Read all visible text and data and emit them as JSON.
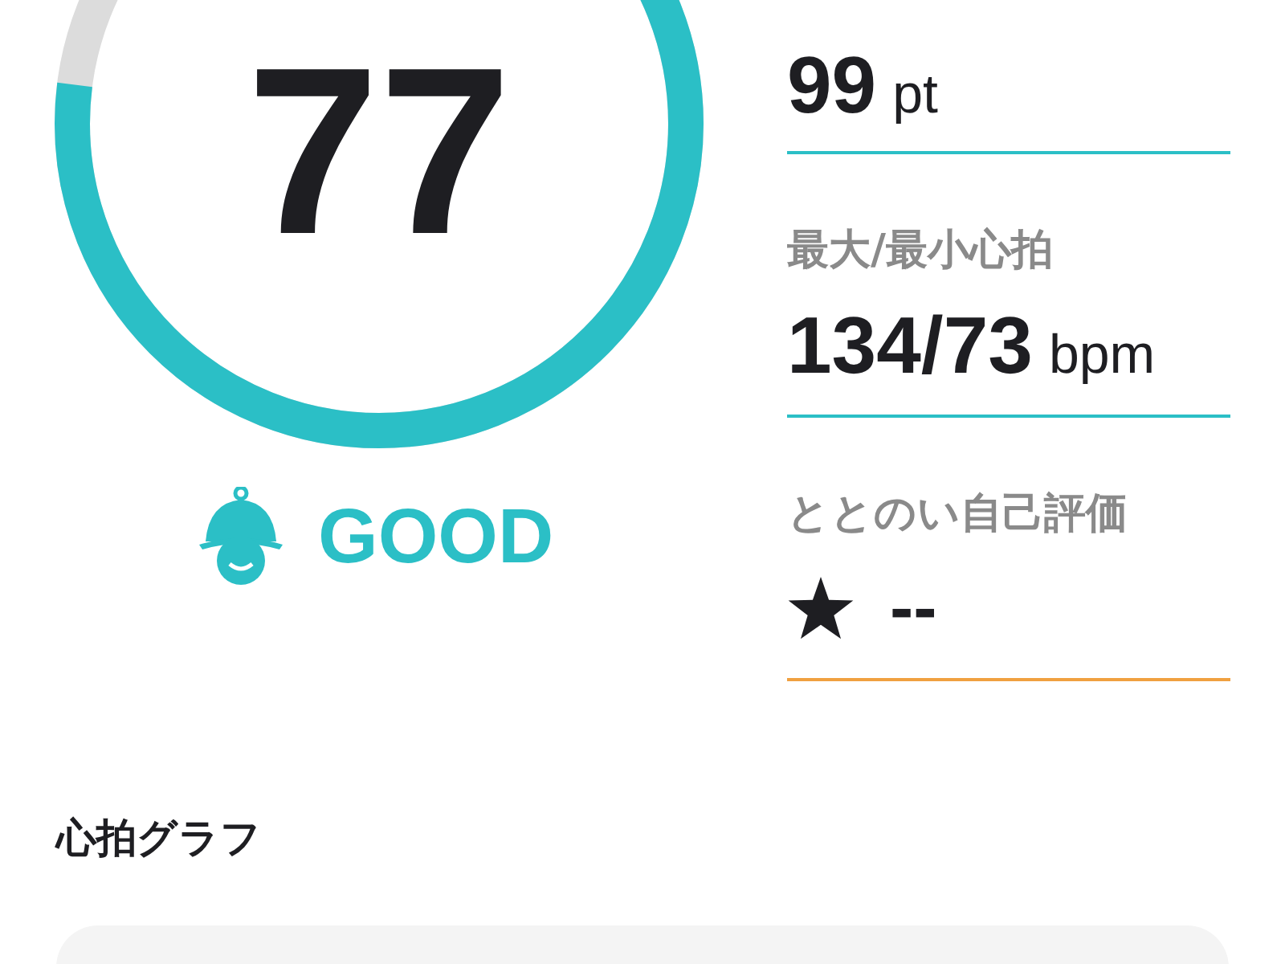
{
  "gauge": {
    "value": "77",
    "status": "GOOD"
  },
  "metrics": [
    {
      "kind": "value",
      "value": "99",
      "unit": "pt",
      "color": "#2bbfc6"
    },
    {
      "kind": "value",
      "label": "最大/最小心拍",
      "value": "134/73",
      "unit": "bpm",
      "color": "#2bbfc6"
    },
    {
      "kind": "rating",
      "label": "ととのい自己評価",
      "value": "--",
      "color": "#f0a040"
    }
  ],
  "section": {
    "title": "心拍グラフ"
  }
}
